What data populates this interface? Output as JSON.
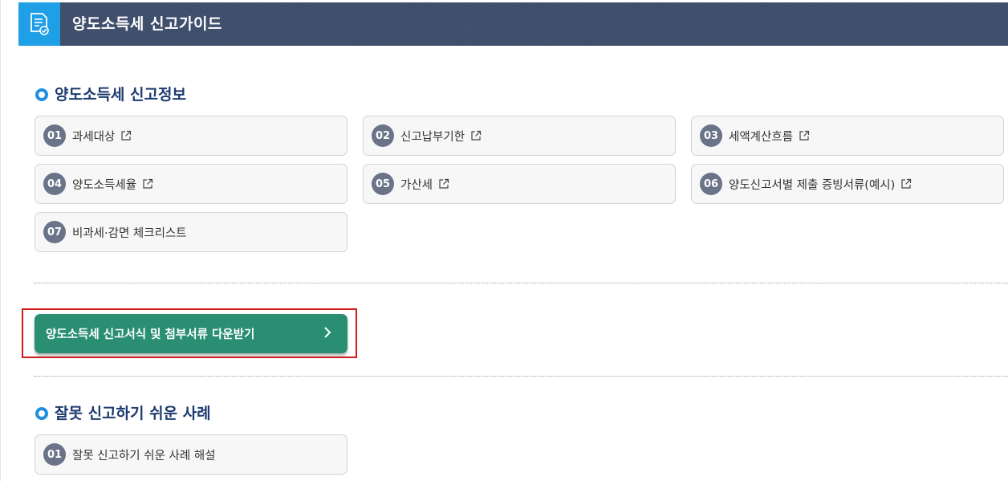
{
  "header": {
    "title": "양도소득세 신고가이드",
    "icon": "document-check-icon",
    "icon_bg": "#1f9fe6",
    "bg": "#3e4e6c"
  },
  "section1": {
    "title": "양도소득세 신고정보",
    "items": [
      {
        "num": "01",
        "label": "과세대상",
        "external": true
      },
      {
        "num": "02",
        "label": "신고납부기한",
        "external": true
      },
      {
        "num": "03",
        "label": "세액계산흐름",
        "external": true
      },
      {
        "num": "04",
        "label": "양도소득세율",
        "external": true
      },
      {
        "num": "05",
        "label": "가산세",
        "external": true
      },
      {
        "num": "06",
        "label": "양도신고서별 제출 증빙서류(예시)",
        "external": true
      },
      {
        "num": "07",
        "label": "비과세·감면 체크리스트",
        "external": false
      }
    ]
  },
  "download": {
    "label": "양도소득세 신고서식 및 첨부서류 다운받기",
    "icon": "chevron-right-icon",
    "color": "#2a8f72",
    "highlight_color": "#d11a1a"
  },
  "section2": {
    "title": "잘못 신고하기 쉬운 사례",
    "items": [
      {
        "num": "01",
        "label": "잘못 신고하기 쉬운 사례 해설",
        "external": false
      }
    ]
  }
}
